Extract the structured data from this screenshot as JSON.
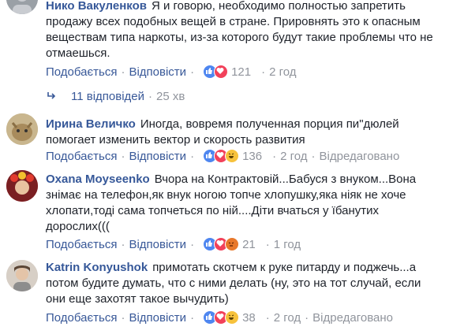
{
  "colors": {
    "link": "#385898",
    "name": "#365899",
    "meta": "#90949c",
    "like": "#4e86f0",
    "love": "#f2415a"
  },
  "actions": {
    "like": "Подобається",
    "reply": "Відповісти",
    "separator": "·"
  },
  "comments": [
    {
      "author": "Нико Вакуленков",
      "lines": [
        "Я и говорю, необходимо полностью запретить",
        "продажу всех подобных вещей в стране. Прировнять это к опасным",
        "веществам типа наркоты, из-за которого будут такие проблемы что не",
        "отмаешься."
      ],
      "reactions": [
        "like-icon",
        "love-icon"
      ],
      "count": "121",
      "time": "2 год",
      "edited": ""
    },
    {
      "author": "Ирина Величко",
      "lines": [
        "Иногда, вовремя полученная порция пи\"дюлей",
        "помогает изменить вектор и скорость развития"
      ],
      "reactions": [
        "like-icon",
        "love-icon",
        "haha-icon"
      ],
      "count": "136",
      "time": "2 год",
      "edited": "Відредаговано"
    },
    {
      "author": "Oxana Moyseenko",
      "lines": [
        "Вчора на Контрактовій...Бабуся з внуком...Вона",
        "знімає на телефон,як внук ногою топче хлопушку,яка ніяк не хоче",
        "хлопати,тоді сама топчеться по ній....Діти вчаться у їбанутих",
        "дорослих((("
      ],
      "reactions": [
        "like-icon",
        "love-icon",
        "angry-icon"
      ],
      "count": "21",
      "time": "1 год",
      "edited": ""
    },
    {
      "author": "Katrin Konyushok",
      "lines": [
        "примотать скотчем к руке питарду и поджечь...а",
        "потом будите думать, что с ними делать (ну, это на тот случай, если",
        "они еще захотят такое вычудить)"
      ],
      "reactions": [
        "like-icon",
        "love-icon",
        "haha-icon"
      ],
      "count": "38",
      "time": "2 год",
      "edited": "Відредаговано"
    }
  ],
  "replies": {
    "label": "11 відповідей",
    "time": "25 хв"
  }
}
